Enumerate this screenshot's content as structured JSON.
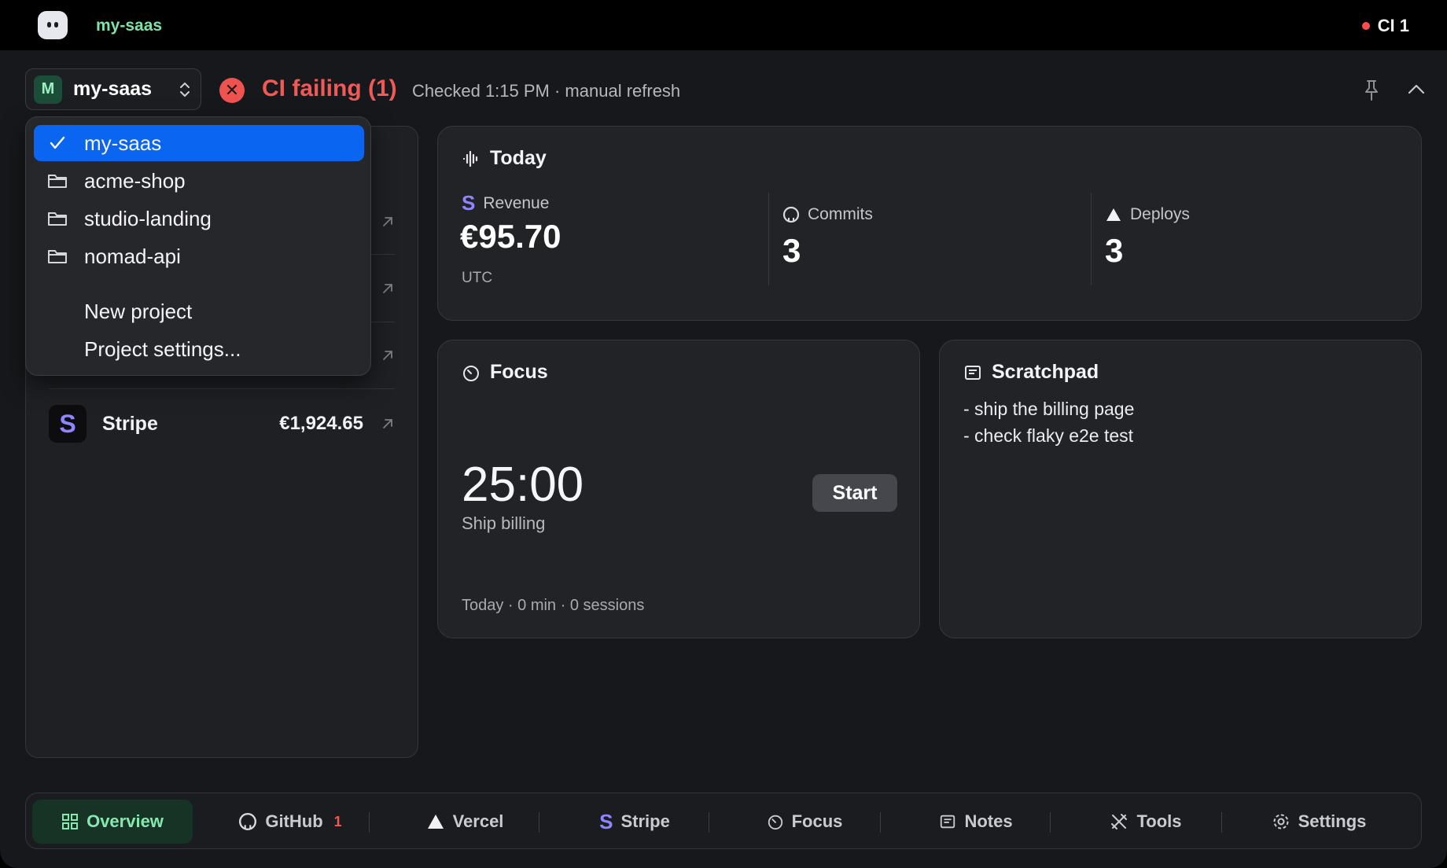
{
  "topbar": {
    "app_name": "my-saas",
    "ci_label": "CI 1"
  },
  "subbar": {
    "project_avatar": "M",
    "project_name": "my-saas",
    "ci_status": "CI failing (1)",
    "checked": "Checked 1:15 PM · manual refresh"
  },
  "dropdown": {
    "projects": [
      "my-saas",
      "acme-shop",
      "studio-landing",
      "nomad-api"
    ],
    "new_project": "New project",
    "settings": "Project settings..."
  },
  "left_panel": {
    "stripe": {
      "logo": "S",
      "name": "Stripe",
      "amount": "€1,924.65"
    }
  },
  "today": {
    "title": "Today",
    "revenue": {
      "label": "Revenue",
      "value": "€95.70",
      "sub": "UTC"
    },
    "commits": {
      "label": "Commits",
      "value": "3"
    },
    "deploys": {
      "label": "Deploys",
      "value": "3"
    }
  },
  "focus": {
    "title": "Focus",
    "timer": "25:00",
    "task": "Ship billing",
    "start": "Start",
    "footer": "Today · 0 min · 0 sessions"
  },
  "scratchpad": {
    "title": "Scratchpad",
    "lines": [
      "- ship the billing page",
      "- check flaky e2e test"
    ]
  },
  "nav": {
    "overview": "Overview",
    "github": "GitHub",
    "github_badge": "1",
    "vercel": "Vercel",
    "stripe": "Stripe",
    "focus": "Focus",
    "notes": "Notes",
    "tools": "Tools",
    "settings": "Settings"
  },
  "colors": {
    "accent_green": "#86e8af",
    "error_red": "#ef5a56",
    "select_blue": "#0a66f0",
    "stripe_purple": "#8f85ff"
  },
  "icons": [
    "app-logo-icon",
    "status-dot-icon",
    "chevron-updown-icon",
    "ci-error-icon",
    "pin-icon",
    "chevron-up-icon",
    "checkmark-icon",
    "folder-icon",
    "refresh-icon",
    "external-link-icon",
    "waveform-icon",
    "stripe-icon",
    "github-icon",
    "vercel-triangle-icon",
    "timer-icon",
    "notes-icon",
    "grid-icon",
    "tools-icon",
    "gear-icon"
  ]
}
